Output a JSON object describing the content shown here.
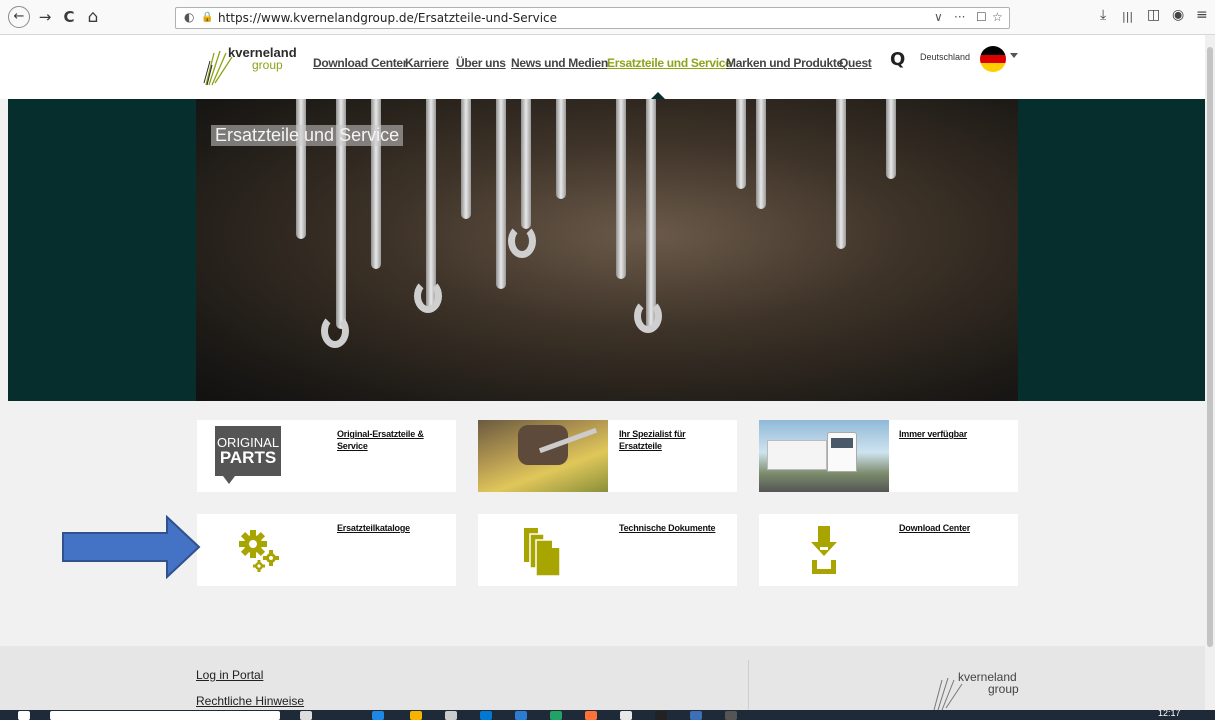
{
  "browser": {
    "url": "https://www.kvernelandgroup.de/Ersatzteile-und-Service",
    "back_icon": "←",
    "forward_icon": "→",
    "reload_icon": "C",
    "home_icon": "⌂",
    "shield_icon": "◐",
    "lock_icon": "🔒",
    "dropdown_icon": "∨",
    "more_icon": "···",
    "pocket_icon": "☐",
    "bookmark_icon": "☆",
    "download_icon": "⤓",
    "library_icon": "|||",
    "sidebar_icon": "◫",
    "account_icon": "◉",
    "menu_icon": "≡"
  },
  "header": {
    "logo_top": "kverneland",
    "logo_bottom": "group",
    "nav": [
      {
        "label": "Download Center"
      },
      {
        "label": "Karriere"
      },
      {
        "label": "Über uns"
      },
      {
        "label": "News und Medien"
      },
      {
        "label": "Ersatzteile und Service"
      },
      {
        "label": "Marken und Produkte"
      },
      {
        "label": "Quest"
      }
    ],
    "search_icon": "Q",
    "country": "Deutschland"
  },
  "hero": {
    "title": "Ersatzteile und Service"
  },
  "tiles": [
    {
      "label": "Original-Ersatzteile & Service",
      "badge_top": "ORIGINAL",
      "badge_bottom": "PARTS"
    },
    {
      "label": "Ihr Spezialist für Ersatzteile"
    },
    {
      "label": "Immer verfügbar"
    },
    {
      "label": "Ersatzteilkataloge"
    },
    {
      "label": "Technische Dokumente"
    },
    {
      "label": "Download Center"
    }
  ],
  "footer": {
    "links": [
      {
        "label": "Log in Portal"
      },
      {
        "label": "Rechtliche Hinweise"
      }
    ],
    "logo_top": "kverneland",
    "logo_bottom": "group"
  },
  "taskbar": {
    "time": "12:17"
  },
  "colors": {
    "brand_green": "#8ca419",
    "hero_bg": "#052e2d",
    "arrow_blue": "#4472c4"
  }
}
